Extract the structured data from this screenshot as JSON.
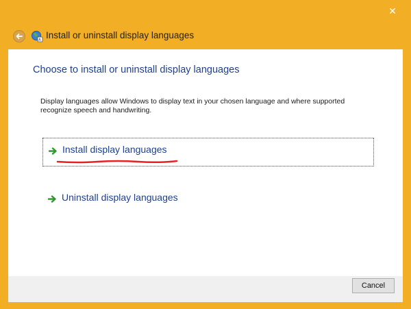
{
  "window": {
    "title": "Install or uninstall display languages",
    "close_glyph": "✕"
  },
  "icons": {
    "back": "back-arrow-icon",
    "window": "globe-language-icon",
    "option_arrow": "green-arrow-icon"
  },
  "content": {
    "heading": "Choose to install or uninstall display languages",
    "description": "Display languages allow Windows to display text in your chosen language and where supported recognize speech and handwriting.",
    "options": [
      {
        "label": "Install display languages",
        "selected": true,
        "underlined": true
      },
      {
        "label": "Uninstall display languages",
        "selected": false
      }
    ]
  },
  "footer": {
    "cancel_label": "Cancel"
  },
  "colors": {
    "frame": "#f2ae25",
    "heading": "#1d3f91",
    "arrow": "#2a9d2a",
    "underline": "#e52121"
  }
}
